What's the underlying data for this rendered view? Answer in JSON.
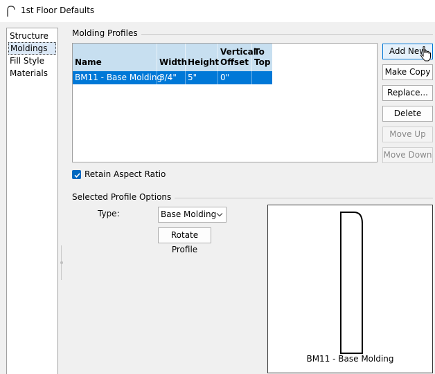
{
  "window": {
    "title": "1st Floor Defaults",
    "icon": "arch-icon"
  },
  "categories": [
    {
      "label": "Structure",
      "selected": false
    },
    {
      "label": "Moldings",
      "selected": true
    },
    {
      "label": "Fill Style",
      "selected": false
    },
    {
      "label": "Materials",
      "selected": false
    }
  ],
  "molding_profiles": {
    "group_title": "Molding Profiles",
    "columns": [
      "Name",
      "Width",
      "Height",
      "Vertical\nOffset",
      "To\nTop"
    ],
    "rows": [
      {
        "name": "BM11 - Base Molding",
        "width": "3/4\"",
        "height": "5\"",
        "vertical_offset": "0\"",
        "to_top": ""
      }
    ],
    "selected_row": 0
  },
  "buttons": {
    "add_new": "Add New",
    "make_copy": "Make Copy",
    "replace": "Replace...",
    "delete": "Delete",
    "move_up": "Move Up",
    "move_down": "Move Down"
  },
  "retain_aspect_ratio": {
    "label": "Retain Aspect Ratio",
    "checked": true
  },
  "selected_profile_options": {
    "group_title": "Selected Profile Options",
    "type_label": "Type:",
    "type_value": "Base Molding",
    "rotate_label": "Rotate Profile"
  },
  "preview": {
    "caption": "BM11 - Base Molding"
  },
  "colors": {
    "selection": "#0078d7",
    "header": "#c7dff0",
    "checkbox": "#0067c0"
  }
}
